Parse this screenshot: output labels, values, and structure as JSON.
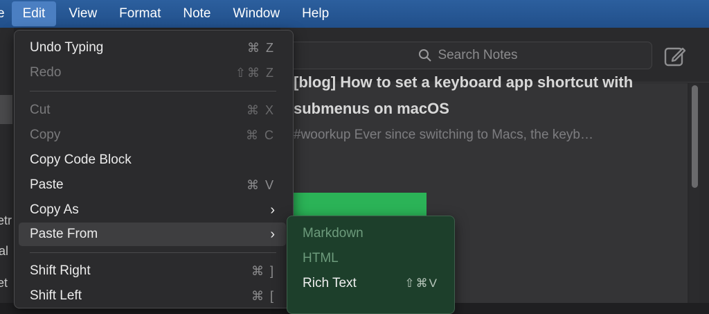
{
  "menubar": {
    "items": [
      "e",
      "Edit",
      "View",
      "Format",
      "Note",
      "Window",
      "Help"
    ]
  },
  "background": {
    "search_placeholder": "Search Notes",
    "note_title": "[blog] How to set a keyboard app shortcut with submenus on macOS",
    "note_snippet": "#woorkup Ever since switching to Macs, the keyb…",
    "sidebar_fragments": [
      "etr",
      "al",
      "et"
    ],
    "accent_color": "#2bb357"
  },
  "edit_menu": {
    "items": [
      {
        "label": "Undo Typing",
        "shortcut": "⌘ Z",
        "enabled": true
      },
      {
        "label": "Redo",
        "shortcut": "⇧⌘ Z",
        "enabled": false
      },
      {
        "label": "Cut",
        "shortcut": "⌘ X",
        "enabled": false
      },
      {
        "label": "Copy",
        "shortcut": "⌘ C",
        "enabled": false
      },
      {
        "label": "Copy Code Block",
        "shortcut": "",
        "enabled": true
      },
      {
        "label": "Paste",
        "shortcut": "⌘ V",
        "enabled": true
      },
      {
        "label": "Copy As",
        "shortcut": "",
        "enabled": true,
        "submenu": true
      },
      {
        "label": "Paste From",
        "shortcut": "",
        "enabled": true,
        "submenu": true,
        "highlighted": true
      },
      {
        "label": "Shift Right",
        "shortcut": "⌘ ]",
        "enabled": true
      },
      {
        "label": "Shift Left",
        "shortcut": "⌘ [",
        "enabled": true
      }
    ]
  },
  "paste_from_submenu": {
    "items": [
      {
        "label": "Markdown",
        "shortcut": "",
        "enabled": false
      },
      {
        "label": "HTML",
        "shortcut": "",
        "enabled": false
      },
      {
        "label": "Rich Text",
        "shortcut": "⇧⌘V",
        "enabled": true
      }
    ]
  }
}
